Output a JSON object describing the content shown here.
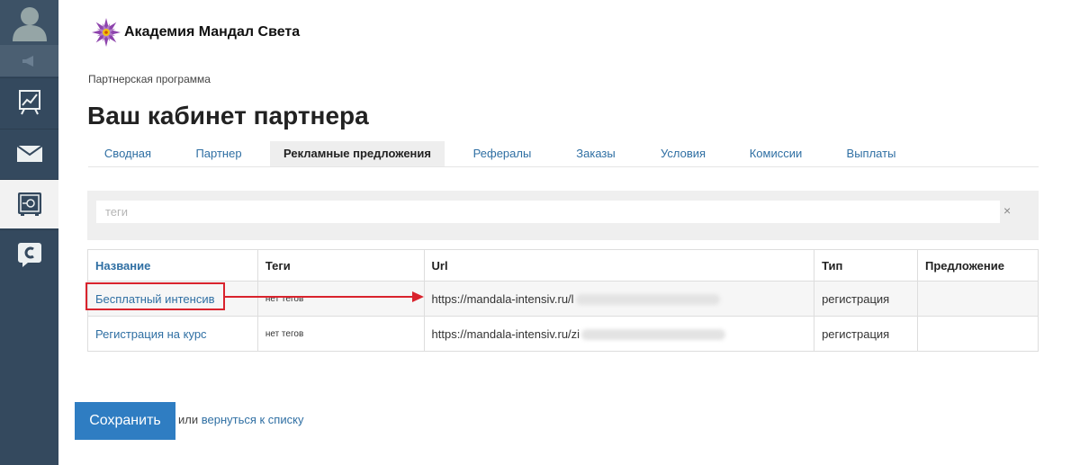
{
  "brand": {
    "name": "Академия Мандал Света"
  },
  "breadcrumb": "Партнерская программа",
  "page_title": "Ваш кабинет партнера",
  "tabs": [
    {
      "label": "Сводная",
      "active": false
    },
    {
      "label": "Партнер",
      "active": false
    },
    {
      "label": "Рекламные предложения",
      "active": true
    },
    {
      "label": "Рефералы",
      "active": false
    },
    {
      "label": "Заказы",
      "active": false
    },
    {
      "label": "Условия",
      "active": false
    },
    {
      "label": "Комиссии",
      "active": false
    },
    {
      "label": "Выплаты",
      "active": false
    }
  ],
  "filter": {
    "placeholder": "теги",
    "clear_icon": "×"
  },
  "table": {
    "headers": [
      "Название",
      "Теги",
      "Url",
      "Тип",
      "Предложение"
    ],
    "rows": [
      {
        "name": "Бесплатный интенсив",
        "tags": "нет тегов",
        "url": "https://mandala-intensiv.ru/l",
        "type": "регистрация",
        "offer": ""
      },
      {
        "name": "Регистрация на курс",
        "tags": "нет тегов",
        "url": "https://mandala-intensiv.ru/zi",
        "type": "регистрация",
        "offer": ""
      }
    ]
  },
  "footer": {
    "save_label": "Сохранить",
    "or_text": "или",
    "back_link": "вернуться к списку"
  },
  "colors": {
    "sidebar": "#34495e",
    "link": "#2f6fa3",
    "primary_button": "#2f7dc2",
    "annotation": "#d9232d"
  }
}
